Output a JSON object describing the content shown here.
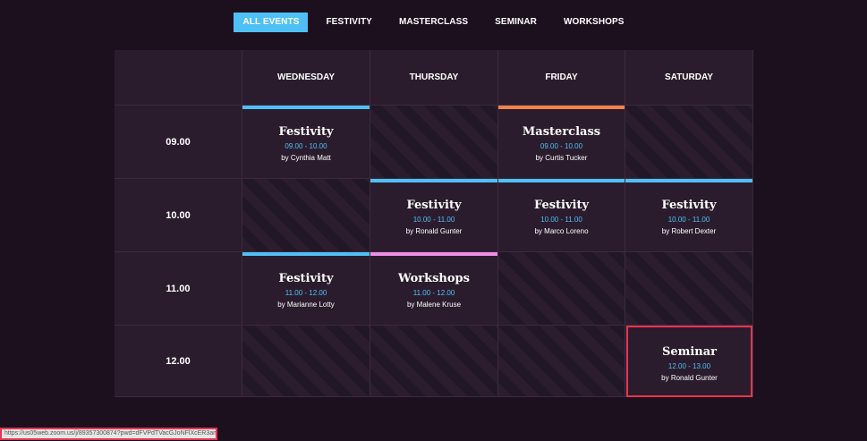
{
  "tabs": [
    "ALL EVENTS",
    "FESTIVITY",
    "MASTERCLASS",
    "SEMINAR",
    "WORKSHOPS"
  ],
  "days": [
    "WEDNESDAY",
    "THURSDAY",
    "FRIDAY",
    "SATURDAY"
  ],
  "times": [
    "09.00",
    "10.00",
    "11.00",
    "12.00"
  ],
  "events": {
    "e1": {
      "title": "Festivity",
      "time": "09.00 - 10.00",
      "host": "by Cynthia Matt",
      "color": "#4fc0f5"
    },
    "e2": {
      "title": "Masterclass",
      "time": "09.00 - 10.00",
      "host": "by Curtis Tucker",
      "color": "#f0824a"
    },
    "e3": {
      "title": "Festivity",
      "time": "10.00 - 11.00",
      "host": "by Ronald Gunter",
      "color": "#4fc0f5"
    },
    "e4": {
      "title": "Festivity",
      "time": "10.00 - 11.00",
      "host": "by Marco Loreno",
      "color": "#4fc0f5"
    },
    "e5": {
      "title": "Festivity",
      "time": "10.00 - 11.00",
      "host": "by Robert Dexter",
      "color": "#4fc0f5"
    },
    "e6": {
      "title": "Festivity",
      "time": "11.00 - 12.00",
      "host": "by Marianne Lotty",
      "color": "#4fc0f5"
    },
    "e7": {
      "title": "Workshops",
      "time": "11.00 - 12.00",
      "host": "by Malene Kruse",
      "color": "#ee8ee8"
    },
    "e8": {
      "title": "Seminar",
      "time": "12.00 - 13.00",
      "host": "by Ronald Gunter",
      "color": "#e8344e"
    }
  },
  "status_url": "https://us05web.zoom.us/j/89357300874?pwd=dFVPdTVacGJoNFlXcER3amNrc2Iidz09"
}
